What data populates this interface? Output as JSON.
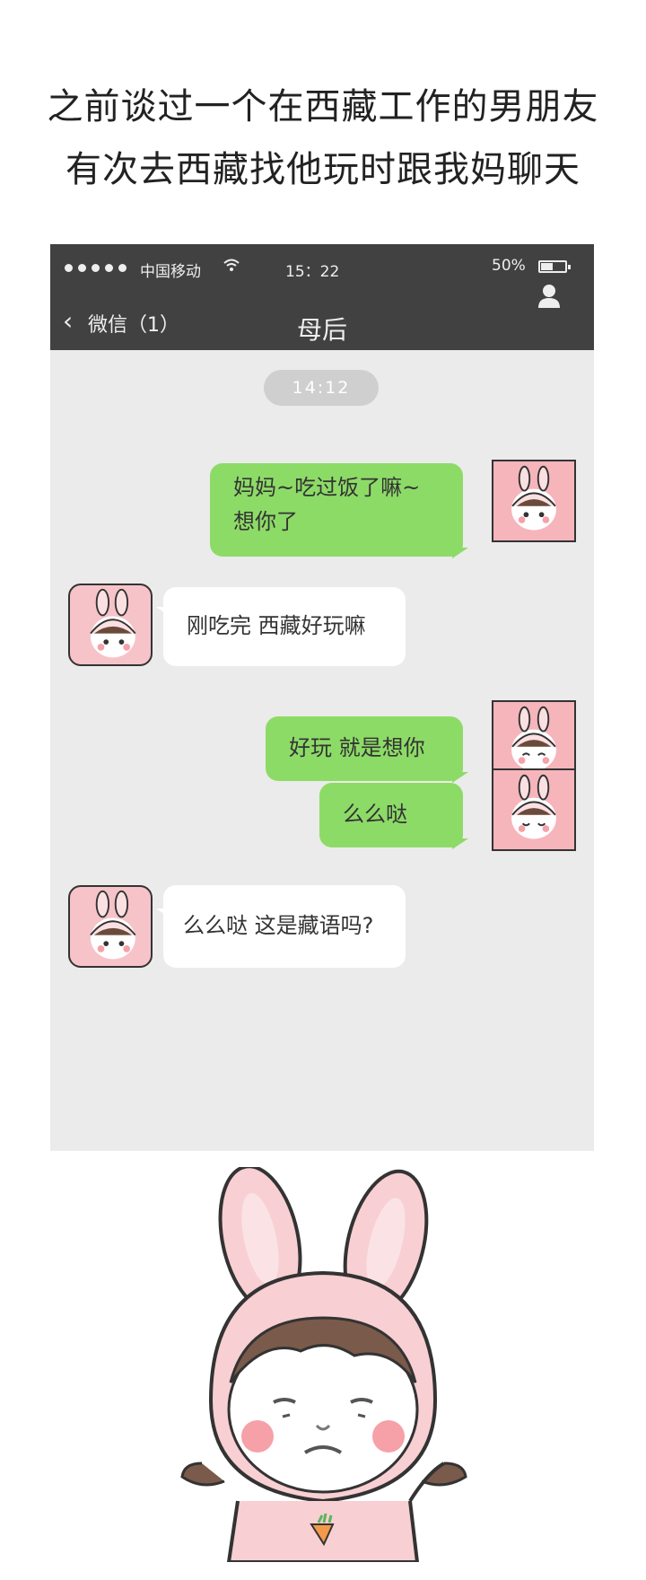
{
  "captions": {
    "line1": "之前谈过一个在西藏工作的男朋友",
    "line2": "有次去西藏找他玩时跟我妈聊天"
  },
  "status_bar": {
    "carrier": "中国移动",
    "time": "15：22",
    "battery": "50%",
    "battery_level": 0.5
  },
  "nav": {
    "back_label": "微信（1）",
    "title": "母后"
  },
  "chat": {
    "timestamp": "14:12",
    "messages": [
      {
        "from": "me",
        "lines": [
          "妈妈~吃过饭了嘛~",
          "想你了"
        ]
      },
      {
        "from": "mom",
        "lines": [
          "刚吃完 西藏好玩嘛"
        ]
      },
      {
        "from": "me",
        "lines": [
          "好玩 就是想你"
        ]
      },
      {
        "from": "me",
        "lines": [
          "么么哒"
        ]
      },
      {
        "from": "mom",
        "lines": [
          "么么哒 这是藏语吗?"
        ]
      }
    ]
  },
  "colors": {
    "topbar": "#414141",
    "chat_bg": "#ebebeb",
    "bubble_me": "#8ddb67",
    "bubble_mom": "#ffffff"
  },
  "icons": [
    "back-chevron-icon",
    "wifi-icon",
    "battery-icon",
    "user-profile-icon"
  ]
}
